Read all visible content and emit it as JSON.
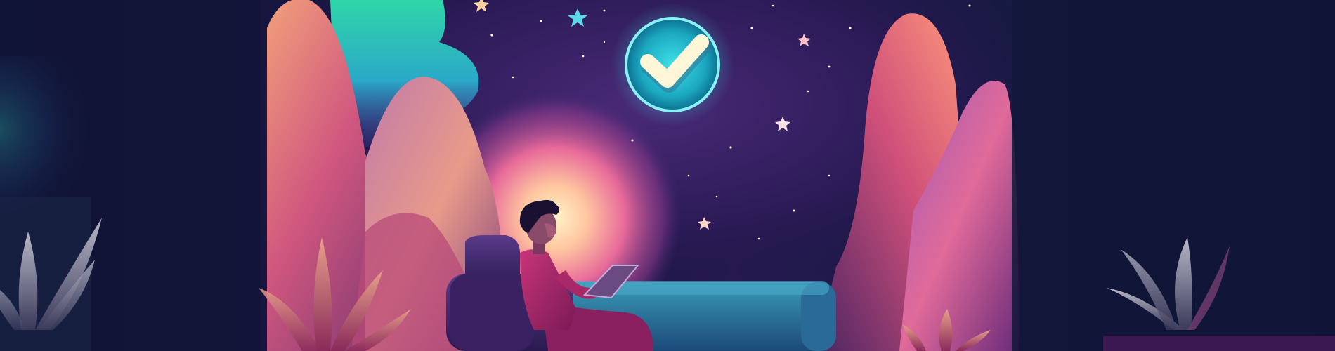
{
  "scene": {
    "subject": "person-relaxing-with-tablet",
    "icons": [
      "check-badge-icon",
      "star-icon",
      "leaf-icon"
    ],
    "palette": {
      "sky_dark": "#0d1030",
      "sky_mid": "#3a1d5c",
      "glow": "#ffd9a0",
      "magenta": "#c5357a",
      "rose": "#e8738e",
      "teal": "#2fc3d1",
      "aurora_green": "#3fd6a0",
      "sofa": "#2b6f92",
      "chair": "#4b2a6b",
      "shirt": "#b72e6e",
      "hair": "#1a1030"
    }
  }
}
